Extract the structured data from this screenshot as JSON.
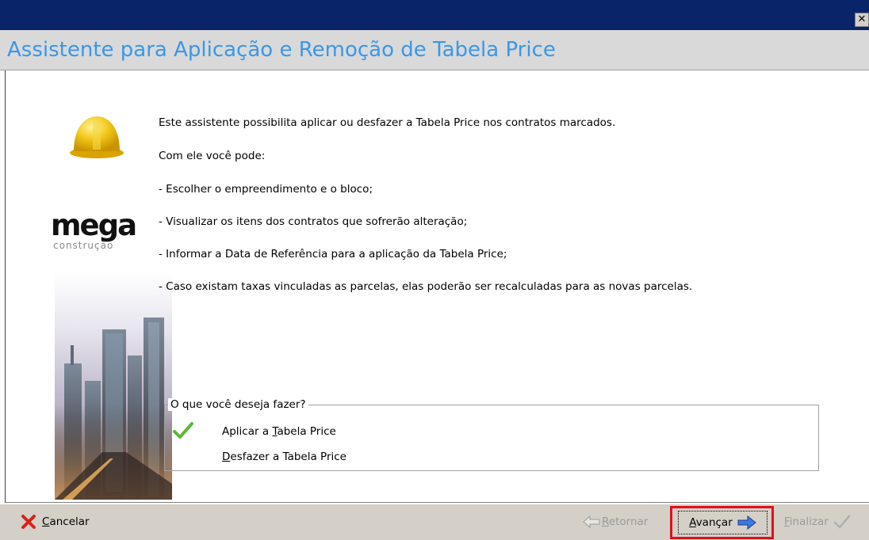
{
  "window": {
    "close_glyph": "✕"
  },
  "header": {
    "title": "Assistente para Aplicação e Remoção de Tabela Price"
  },
  "branding": {
    "logo": "mega",
    "logo_sub": "construção"
  },
  "intro": {
    "line1": "Este assistente possibilita aplicar ou desfazer a Tabela Price nos contratos marcados.",
    "line2": "Com ele você pode:",
    "items": [
      "- Escolher o empreendimento e o bloco;",
      "- Visualizar os itens dos contratos que sofrerão alteração;",
      "- Informar a Data de Referência para a aplicação da Tabela Price;",
      "- Caso existam taxas vinculadas as parcelas, elas poderão ser recalculadas para as novas parcelas."
    ]
  },
  "choice": {
    "legend": "O que você deseja fazer?",
    "options": [
      {
        "prefix": "Aplicar a ",
        "mnemonic": "T",
        "suffix": "abela Price",
        "selected": true
      },
      {
        "prefix": "",
        "mnemonic": "D",
        "suffix": "esfazer a Tabela Price",
        "selected": false
      }
    ]
  },
  "buttons": {
    "cancelar": {
      "mnemonic": "C",
      "rest": "ancelar",
      "icon": "red-x-icon"
    },
    "retornar": {
      "mnemonic": "R",
      "rest": "etornar",
      "icon": "left-arrow-icon",
      "enabled": false
    },
    "avancar": {
      "mnemonic": "A",
      "rest": "vançar",
      "icon": "right-arrow-icon",
      "enabled": true
    },
    "finalizar": {
      "mnemonic": "F",
      "rest": "inalizar",
      "icon": "check-icon",
      "enabled": false
    }
  },
  "colors": {
    "titlebar": "#0a246a",
    "title_text": "#3a97e8",
    "header_bg": "#d9d9d9",
    "button_bar": "#d4d0c8",
    "highlight": "#e0101c"
  }
}
